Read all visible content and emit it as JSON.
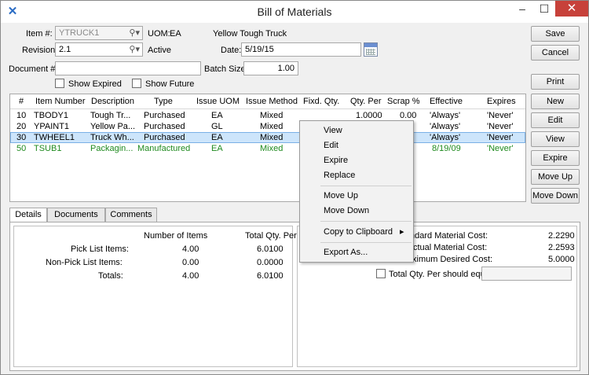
{
  "window": {
    "title": "Bill of Materials",
    "minimize": "–",
    "maximize": "☐",
    "close": "✕"
  },
  "form": {
    "item_label": "Item #:",
    "item_value": "YTRUCK1",
    "uom_label": "UOM:",
    "uom_value": "EA",
    "item_description": "Yellow Tough Truck",
    "revision_label": "Revision:",
    "revision_value": "2.1",
    "revision_status": "Active",
    "date_label": "Date:",
    "date_value": "5/19/15",
    "document_label": "Document #:",
    "document_value": "",
    "batch_label": "Batch Size:",
    "batch_value": "1.00",
    "show_expired": "Show Expired",
    "show_future": "Show Future"
  },
  "buttons": {
    "save": "Save",
    "cancel": "Cancel",
    "print": "Print",
    "new": "New",
    "edit": "Edit",
    "view": "View",
    "expire": "Expire",
    "move_up": "Move Up",
    "move_down": "Move Down"
  },
  "grid": {
    "headers": [
      "#",
      "Item Number",
      "Description",
      "Type",
      "Issue UOM",
      "Issue Method",
      "Fixd. Qty.",
      "Qty. Per",
      "Scrap %",
      "Effective",
      "Expires"
    ],
    "rows": [
      {
        "num": "10",
        "item": "TBODY1",
        "desc": "Tough Tr...",
        "type": "Purchased",
        "uom": "EA",
        "method": "Mixed",
        "fixd": "",
        "qty": "1.0000",
        "scrap": "0.00",
        "eff": "'Always'",
        "exp": "'Never'"
      },
      {
        "num": "20",
        "item": "YPAINT1",
        "desc": "Yellow Pa...",
        "type": "Purchased",
        "uom": "GL",
        "method": "Mixed",
        "fixd": "",
        "qty": "",
        "scrap": "",
        "eff": "'Always'",
        "exp": "'Never'"
      },
      {
        "num": "30",
        "item": "TWHEEL1",
        "desc": "Truck Wh...",
        "type": "Purchased",
        "uom": "EA",
        "method": "Mixed",
        "fixd": "",
        "qty": "",
        "scrap": "",
        "eff": "'Always'",
        "exp": "'Never'"
      },
      {
        "num": "50",
        "item": "TSUB1",
        "desc": "Packagin...",
        "type": "Manufactured",
        "uom": "EA",
        "method": "Mixed",
        "fixd": "",
        "qty": "",
        "scrap": "",
        "eff": "8/19/09",
        "exp": "'Never'"
      }
    ]
  },
  "tabs": [
    "Details",
    "Documents",
    "Comments"
  ],
  "details": {
    "col_items": "Number of Items",
    "col_total": "Total Qty. Per",
    "rows": [
      {
        "label": "Pick List Items:",
        "items": "4.00",
        "total": "6.0100"
      },
      {
        "label": "Non-Pick List Items:",
        "items": "0.00",
        "total": "0.0000"
      },
      {
        "label": "Totals:",
        "items": "4.00",
        "total": "6.0100"
      }
    ],
    "costs": [
      {
        "label": "ndard Material Cost:",
        "value": "2.2290"
      },
      {
        "label": "ctual Material Cost:",
        "value": "2.2593"
      },
      {
        "label": "ximum Desired Cost:",
        "value": "5.0000"
      }
    ],
    "total_qty_check": "Total Qty. Per should equal"
  },
  "context_menu": {
    "view": "View",
    "edit": "Edit",
    "expire": "Expire",
    "replace": "Replace",
    "move_up": "Move Up",
    "move_down": "Move Down",
    "copy": "Copy to Clipboard",
    "arrow": "▸",
    "export": "Export As..."
  },
  "colors": {
    "manufactured": "#1f8a1f",
    "selection": "#cde5fb",
    "close": "#c7413a"
  }
}
